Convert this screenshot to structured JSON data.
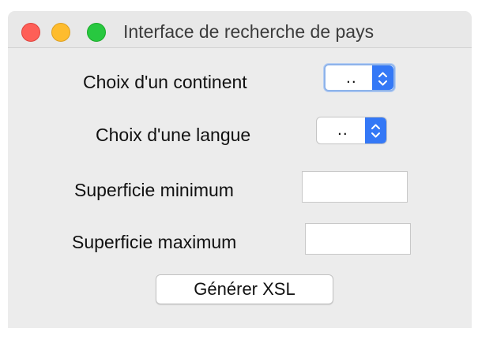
{
  "window": {
    "title": "Interface de recherche de pays"
  },
  "form": {
    "continent": {
      "label": "Choix d'un continent",
      "selected": ".."
    },
    "language": {
      "label": "Choix d'une langue",
      "selected": ".."
    },
    "area_min": {
      "label": "Superficie minimum",
      "value": ""
    },
    "area_max": {
      "label": "Superficie maximum",
      "value": ""
    },
    "generate_button": "Générer XSL"
  },
  "icons": {
    "traffic_lights": [
      "close-icon",
      "minimize-icon",
      "zoom-icon"
    ],
    "combo_arrows": "up-down-chevron-icon"
  },
  "colors": {
    "accent": "#3478f6",
    "close": "#fe5f57",
    "minimize": "#febc2e",
    "zoom": "#28c840",
    "window_bg": "#ececec"
  }
}
